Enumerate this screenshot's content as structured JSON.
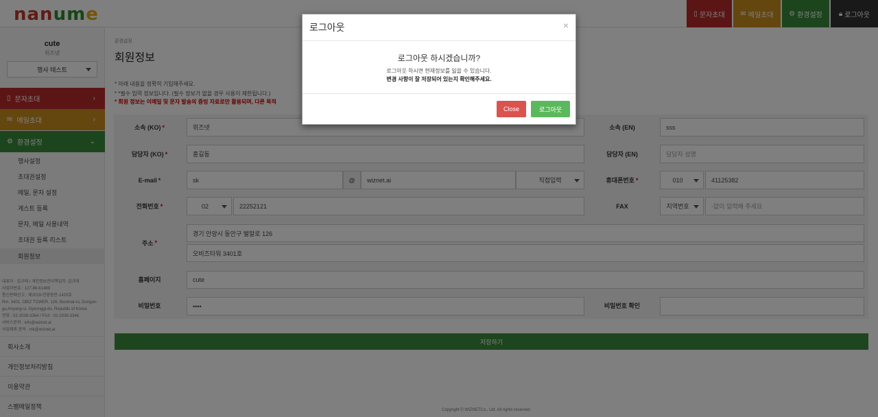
{
  "header": {
    "logo": [
      "nan",
      "um",
      "e"
    ],
    "buttons": {
      "sms": "문자초대",
      "mail": "메일초대",
      "settings": "환경설정",
      "logout": "로그아웃"
    },
    "colors": {
      "sms": "#b82a2a",
      "mail": "#c98c1e",
      "settings": "#3a8a3a",
      "logout": "#333333"
    }
  },
  "sidebar": {
    "user_name": "cute",
    "user_sub": "위즈넷",
    "event_select": "행사 테스트",
    "menus": {
      "sms": "문자초대",
      "mail": "메일초대",
      "settings": "환경설정"
    },
    "sub_items": [
      "행사설정",
      "초대권설정",
      "메일, 문자 설정",
      "게스트 등록",
      "문자, 메일 사용내역",
      "초대권 등록 리스트",
      "회원정보"
    ],
    "company_info": [
      "대표자 : 김규태 / 개인정보관리책임자 :김규태",
      "사업자번호 : 127-86-61489",
      "통신판매신고 : 제2019-안양동안-1425호",
      "Rm. 3401, OBIZ TOWER, 126, Beolmal-ro, Dongan-gu,Anyang-si, Gyeonggi-do, Republic of Korea",
      "전화 : 02-2038-3364 / FAX : 02-2038-3346",
      "서비스문의 : info@wiznet.al",
      "사업제휴 문의 : mk@wiznet.al"
    ],
    "footer_links": [
      "회사소개",
      "개인정보처리방침",
      "이용약관",
      "스팸메일정책"
    ]
  },
  "main": {
    "breadcrumb": "환경설정",
    "title": "회원정보",
    "notes": [
      "* 아래 내용을 정확히 기입해주세요.",
      "* *필수 입력 정보입니다. (필수 정보가 없을 경우 사용이 제한됩니다.)",
      "* 회원 정보는 이메일 및 문자 발송의 증빙 자료로만 활용되며, 다른 목적"
    ],
    "form": {
      "org_ko_label": "소속 (KO)",
      "org_ko_value": "위즈넷",
      "org_en_label": "소속 (EN)",
      "org_en_value": "sss",
      "manager_ko_label": "담당자 (KO)",
      "manager_ko_value": "홍길동",
      "manager_en_label": "담당자 (EN)",
      "manager_en_placeholder": "담당자 성명",
      "email_label": "E-mail",
      "email_id": "sk",
      "email_at": "@",
      "email_domain": "wiznet.ai",
      "email_select": "직접입력",
      "mobile_label": "휴대폰번호",
      "mobile_prefix": "010",
      "mobile_number": "41125382",
      "phone_label": "전화번호",
      "phone_area": "02",
      "phone_number": "22252121",
      "fax_label": "FAX",
      "fax_area": "지역번호",
      "fax_placeholder": "-없이 입력해 주세요",
      "address_label": "주소",
      "address_1": "경기 안양시 동안구 벌말로 126",
      "address_2": "오비즈타워 3401호",
      "homepage_label": "홈페이지",
      "homepage_value": "cute",
      "password_label": "비밀번호",
      "password_value": "••••",
      "password_confirm_label": "비밀번호 확인"
    },
    "save_button": "저장하기",
    "copyright": "Copyright © WIZNETCo., Ltd. All rights reserved."
  },
  "modal": {
    "title": "로그아웃",
    "close_x": "×",
    "question": "로그아웃 하시겠습니까?",
    "line1": "로그아웃 하시면 현재정보를 잃을 수 있습니다.",
    "line2": "변경 사항이 잘 저장되어 있는지 확인해주세요.",
    "close_button": "Close",
    "confirm_button": "로그아웃",
    "colors": {
      "close": "#d9534f",
      "confirm": "#5cb85c"
    }
  }
}
